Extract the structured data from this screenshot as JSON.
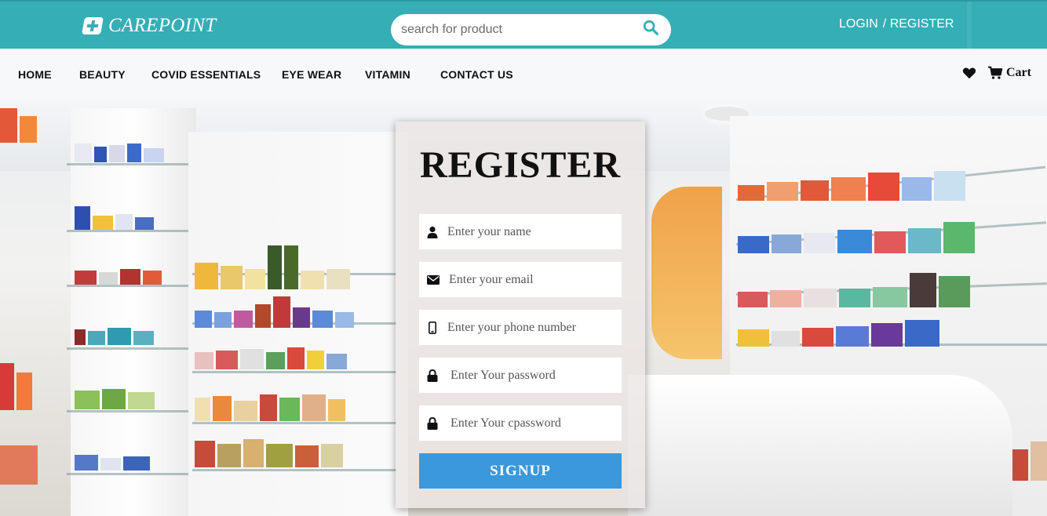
{
  "brand": {
    "name": "CAREPOINT"
  },
  "search": {
    "placeholder": "search for product"
  },
  "auth": {
    "login": "LOGIN",
    "register": "/ REGISTER"
  },
  "nav": {
    "items": [
      {
        "label": "HOME"
      },
      {
        "label": "BEAUTY"
      },
      {
        "label": "COVID ESSENTIALS"
      },
      {
        "label": "EYE WEAR"
      },
      {
        "label": "VITAMIN"
      },
      {
        "label": "CONTACT US"
      }
    ],
    "cart_label": "Cart"
  },
  "register": {
    "title": "REGISTER",
    "fields": [
      {
        "placeholder": "Enter your name",
        "icon": "user-icon"
      },
      {
        "placeholder": "Enter your email",
        "icon": "envelope-icon"
      },
      {
        "placeholder": "Enter your phone number",
        "icon": "mobile-icon"
      },
      {
        "placeholder": "Enter Your password",
        "icon": "lock-icon"
      },
      {
        "placeholder": "Enter Your cpassword",
        "icon": "lock-icon"
      }
    ],
    "submit_label": "SIGNUP"
  },
  "colors": {
    "topbar": "#35aeb5",
    "navbar": "#f7f8fa",
    "button": "#3b98db"
  }
}
